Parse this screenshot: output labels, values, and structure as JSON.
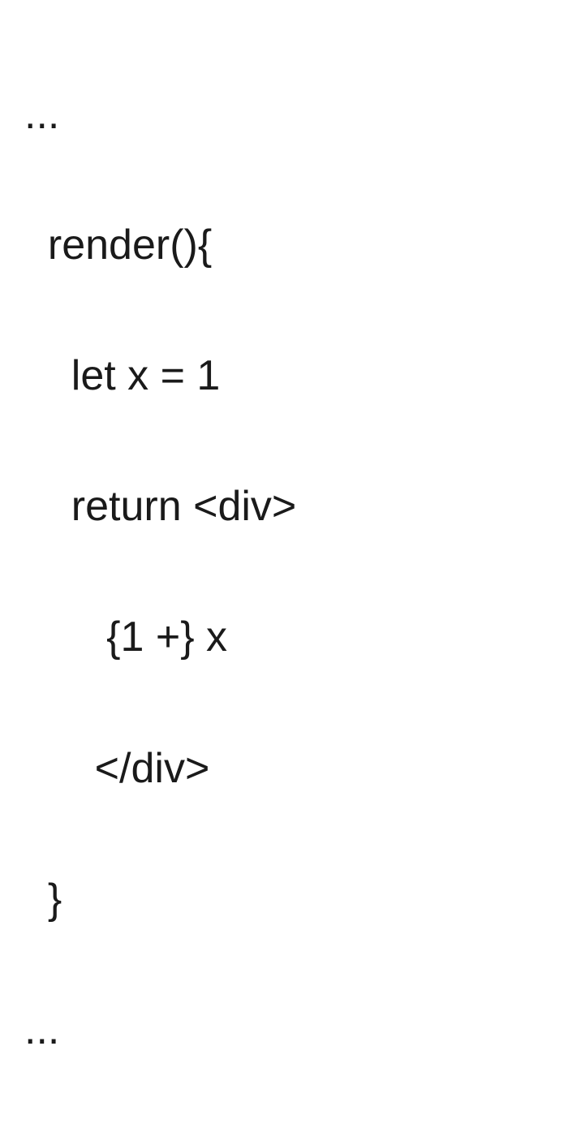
{
  "code": {
    "lines": [
      "...",
      "  render(){",
      "    let x = 1",
      "    return <div>",
      "       {1 +} x",
      "      </div>",
      "  }",
      "..."
    ]
  }
}
